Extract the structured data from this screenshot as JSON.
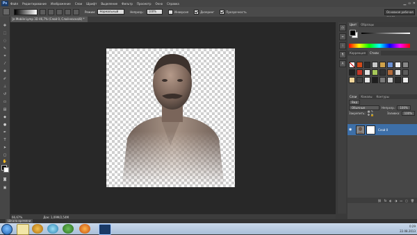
{
  "app": {
    "logo": "Ps"
  },
  "menu": [
    "Файл",
    "Редактирование",
    "Изображение",
    "Слои",
    "Шрифт",
    "Выделение",
    "Фильтр",
    "Просмотр",
    "Окно",
    "Справка"
  ],
  "options_bar": {
    "mode_label": "Режим:",
    "mode_value": "Нормальный",
    "opacity_label": "Непрозр.:",
    "opacity_value": "100%",
    "inverse_label": "Инверсия",
    "dither_label": "Дизеринг",
    "transparency_label": "Прозрачность",
    "workspace": "Основная рабочая среда"
  },
  "document": {
    "tab_label": "Je Mobile Lymp 3D 46,7% (Слой 0, Слой-маска/8) *"
  },
  "statusbar": {
    "zoom": "66,67%",
    "doc_info": "Док: 1,09M/2,54M"
  },
  "minibridge": {
    "label": "Шкала времени"
  },
  "panels": {
    "color_tabs": [
      "Цвет",
      "Образцы"
    ],
    "styles_tabs": [
      "Коррекция",
      "Стили"
    ],
    "layers_tabs": [
      "Слои",
      "Каналы",
      "Контуры"
    ],
    "kind_label": "Вид",
    "blend_mode": "Обычные",
    "opacity_label": "Непрозр.:",
    "opacity_value": "100%",
    "lock_label": "Закрепить:",
    "fill_label": "Заливка:",
    "fill_value": "100%",
    "layer_name": "Слой 0"
  },
  "tray": {
    "time": "0:29",
    "date": "22.08.2013"
  },
  "colors": {
    "accent": "#3d6fa8"
  }
}
